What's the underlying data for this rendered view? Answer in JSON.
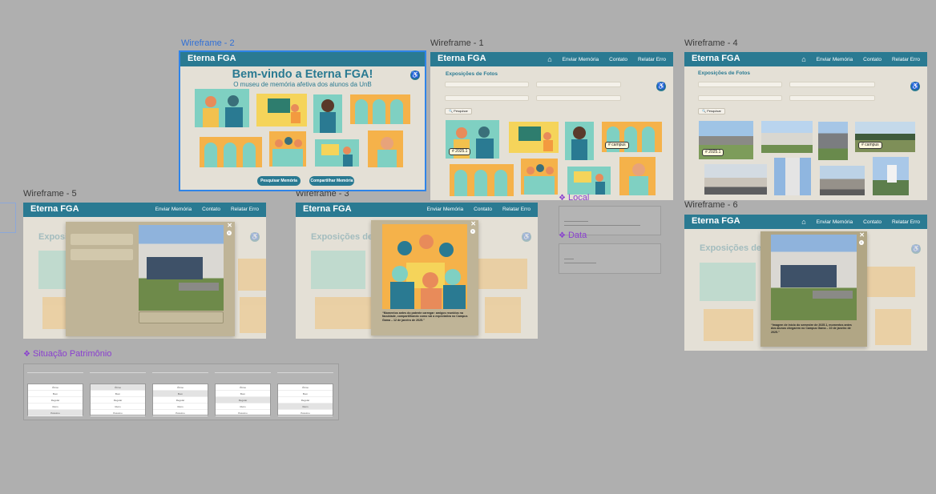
{
  "frames": {
    "wf2": {
      "label": "Wireframe - 2",
      "brand": "Eterna FGA",
      "title": "Bem-vindo a Eterna FGA!",
      "subtitle": "O museu de memória afetiva dos alunos da UnB",
      "btn_search": "Pesquisar Memória",
      "btn_share": "Compartilhar Memória"
    },
    "wf1": {
      "label": "Wireframe - 1",
      "brand": "Eterna FGA",
      "nav": [
        "Enviar Memória",
        "Contato",
        "Relatar Erro"
      ],
      "section": "Exposições de Fotos",
      "search_btn": "Pesquisar",
      "tags": [
        "# 2025.1",
        "# campus"
      ]
    },
    "wf4": {
      "label": "Wireframe - 4",
      "brand": "Eterna FGA",
      "nav": [
        "Enviar Memória",
        "Contato",
        "Relatar Erro"
      ],
      "section": "Exposições de Fotos",
      "search_btn": "Pesquisar",
      "tags": [
        "# 2025.1",
        "# campus"
      ]
    },
    "wf5": {
      "label": "Wireframe - 5",
      "brand": "Eterna FGA",
      "nav": [
        "Enviar Memória",
        "Contato",
        "Relatar Erro"
      ],
      "section": "Exposições de Fotos"
    },
    "wf3": {
      "label": "Wireframe - 3",
      "brand": "Eterna FGA",
      "nav": [
        "Enviar Memória",
        "Contato",
        "Relatar Erro"
      ],
      "section": "Exposições de Fotos",
      "caption": "“Momentos antes do patente carregar: amigos reunidos na faculdade, compartilhando como vai a expectativa no Campus Gama – 12 de janeiro de 2025.”"
    },
    "wf6": {
      "label": "Wireframe - 6",
      "brand": "Eterna FGA",
      "nav": [
        "Enviar Memória",
        "Contato",
        "Relatar Erro"
      ],
      "section": "Exposições de Fotos",
      "caption": "“Imagem de início do semestre de 2025.1, momentos antes dos alunos chegarem no Campus Gama – 10 de janeiro de 2025.”"
    }
  },
  "components": {
    "local": "Local",
    "data": "Data",
    "situacao": "Situação Patrimônio",
    "dropdown_options": [
      "Ótimo",
      "Bom",
      "Regular",
      "Ruim",
      "Péssimo"
    ]
  },
  "icons": [
    "home-icon",
    "accessibility-icon",
    "close-icon",
    "info-icon",
    "component-icon"
  ],
  "colors": {
    "brand": "#2a7a92",
    "frame_bg": "#e4e0d6",
    "canvas": "#afafaf",
    "selection": "#2f84e8",
    "component": "#8a3fd0",
    "modal": "#bfb497"
  }
}
